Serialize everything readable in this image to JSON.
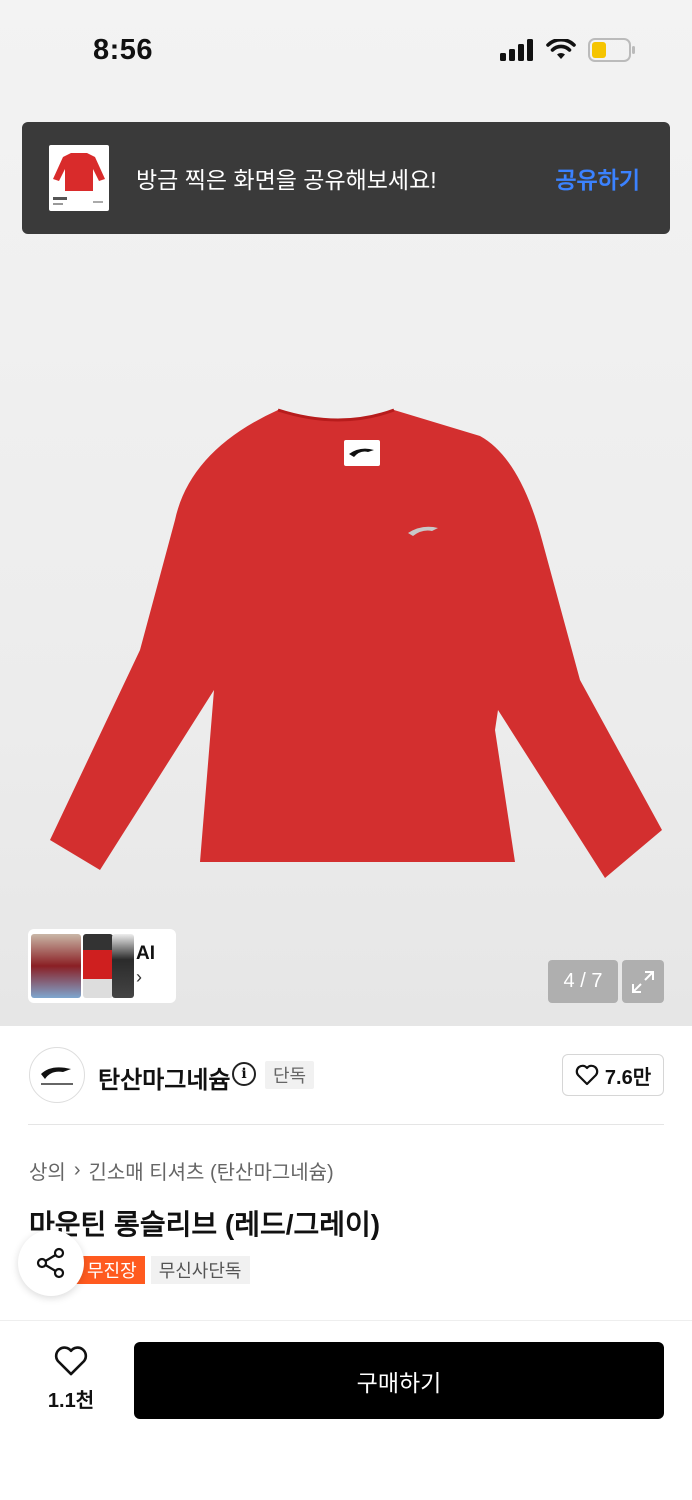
{
  "status_bar": {
    "time": "8:56",
    "battery_color": "#f5c400"
  },
  "toast": {
    "message": "방금 찍은 화면을 공유해보세요!",
    "action_label": "공유하기",
    "action_color": "#3b82ff"
  },
  "gallery": {
    "ai_label": "AI",
    "counter": "4 / 7",
    "current_index": 4,
    "total": 7
  },
  "brand": {
    "name": "탄산마그네슘",
    "badge": "단독",
    "likes": "7.6만"
  },
  "breadcrumb": {
    "category": "상의",
    "subcategory": "긴소매 티셔츠 (탄산마그네슘)"
  },
  "product": {
    "title": "마운틴 롱슬리브 (레드/그레이)",
    "color": "#d92b2b"
  },
  "badges": {
    "orange": "무진장",
    "gray": "무신사단독",
    "orange_color": "#ff5a1f"
  },
  "bottom_bar": {
    "wish_count": "1.1천",
    "buy_label": "구매하기"
  }
}
